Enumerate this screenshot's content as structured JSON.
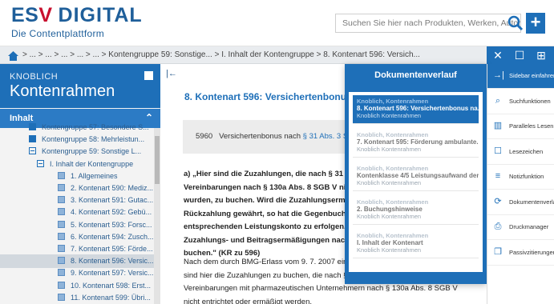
{
  "header": {
    "logo_esv": "ES",
    "logo_v": "V",
    "logo_digital": "DIGITAL",
    "logo_sub": "Die Contentplattform",
    "search_placeholder": "Suchen Sie hier nach Produkten, Werken, Autoren",
    "add_button": "+"
  },
  "breadcrumb": "> ... > ... > ... > ... > ... > Kontengruppe 59: Sonstige... > I. Inhalt der Kontengruppe > 8. Kontenart 596: Versich...",
  "toolbar_top": {
    "close": "✕",
    "bookmark": "☐",
    "fullscreen": "⊞"
  },
  "sidebar": {
    "publisher": "KNOBLICH",
    "book": "Kontenrahmen",
    "section": "Inhalt",
    "tree": [
      {
        "label": "Kontengruppe 57: Besondere S...",
        "icon": "sq",
        "indent": 0
      },
      {
        "label": "Kontengruppe 58: Mehrleistun...",
        "icon": "sq",
        "indent": 0
      },
      {
        "label": "Kontengruppe 59: Sonstige L...",
        "icon": "minus",
        "indent": 0
      },
      {
        "label": "I. Inhalt der Kontengruppe",
        "icon": "minus",
        "indent": 1
      },
      {
        "label": "1. Allgemeines",
        "icon": "doc",
        "indent": 2
      },
      {
        "label": "2. Kontenart 590: Mediz...",
        "icon": "doc",
        "indent": 2
      },
      {
        "label": "3. Kontenart 591: Gutac...",
        "icon": "doc",
        "indent": 2
      },
      {
        "label": "4. Kontenart 592: Gebü...",
        "icon": "doc",
        "indent": 2
      },
      {
        "label": "5. Kontenart 593: Forsc...",
        "icon": "doc",
        "indent": 2
      },
      {
        "label": "6. Kontenart 594: Zusch...",
        "icon": "doc",
        "indent": 2
      },
      {
        "label": "7. Kontenart 595: Förde...",
        "icon": "doc",
        "indent": 2
      },
      {
        "label": "8. Kontenart 596: Versic...",
        "icon": "doc",
        "indent": 2,
        "selected": true
      },
      {
        "label": "9. Kontenart 597: Versic...",
        "icon": "doc",
        "indent": 2
      },
      {
        "label": "10. Kontenart 598: Erst...",
        "icon": "doc",
        "indent": 2
      },
      {
        "label": "11. Kontenart 599: Übri...",
        "icon": "doc",
        "indent": 2
      }
    ]
  },
  "main": {
    "title": "8. Kontenart 596: Versichertenbonus na",
    "box_number": "5960",
    "box_text": "Versichertenbonus nach",
    "box_link": "§ 31 Abs. 3 SGB",
    "quote_lines": [
      "a) „Hier sind die Zuzahlungen, die nach § 31 Abs.",
      "Vereinbarungen nach § 130a Abs. 8 SGB V nicht e",
      "wurden, zu buchen. Wird die Zuzahlungsermäßi",
      "Rückzahlung gewährt, so hat die Gegenbuchung",
      "entsprechenden Leistungskonto zu erfolgen. Hi",
      "Zuzahlungs- und Beitragsermäßigungen nach §",
      "buchen.\" (KR zu 596)"
    ],
    "body_lines": [
      "Nach dem durch BMG-Erlass vom 9. 7. 2007 eingef",
      "sind hier die Zuzahlungen zu buchen, die nach § 31 Abs. 3 SGB V aufgrund von",
      "Vereinbarungen mit pharmazeutischen Unternehmern nach § 130a Abs. 8 SGB V",
      "nicht entrichtet oder ermäßigt werden."
    ]
  },
  "history": {
    "title": "Dokumentenverlauf",
    "items": [
      {
        "book": "Knoblich, Kontenrahmen",
        "title": "8. Kontenart 596: Versichertenbonus na...",
        "sub": "Knoblich Kontenrahmen",
        "active": true
      },
      {
        "book": "Knoblich, Kontenrahmen",
        "title": "7. Kontenart 595: Förderung ambulante...",
        "sub": "Knoblich Kontenrahmen"
      },
      {
        "book": "Knoblich, Kontenrahmen",
        "title": "Kontenklasse 4/5 Leistungsaufwand der...",
        "sub": "Knoblich Kontenrahmen"
      },
      {
        "book": "Knoblich, Kontenrahmen",
        "title": "2. Buchungshinweise",
        "sub": "Knoblich Kontenrahmen"
      },
      {
        "book": "Knoblich, Kontenrahmen",
        "title": "I. Inhalt der Kontenart",
        "sub": "Knoblich Kontenrahmen"
      }
    ]
  },
  "right_panel": [
    {
      "label": "Sidebar einfahren",
      "icon": "→|"
    },
    {
      "label": "Suchfunktionen",
      "icon": "⌕"
    },
    {
      "label": "Paralleles Lesen",
      "icon": "▥"
    },
    {
      "label": "Lesezeichen",
      "icon": "☐"
    },
    {
      "label": "Notizfunktion",
      "icon": "≡"
    },
    {
      "label": "Dokumentenverlauf",
      "icon": "⟳"
    },
    {
      "label": "Druckmanager",
      "icon": "⎙"
    },
    {
      "label": "Passivzitierungen",
      "icon": "❐"
    }
  ],
  "colors": {
    "brand_blue": "#1e6fb8",
    "brand_red": "#c8102e"
  }
}
